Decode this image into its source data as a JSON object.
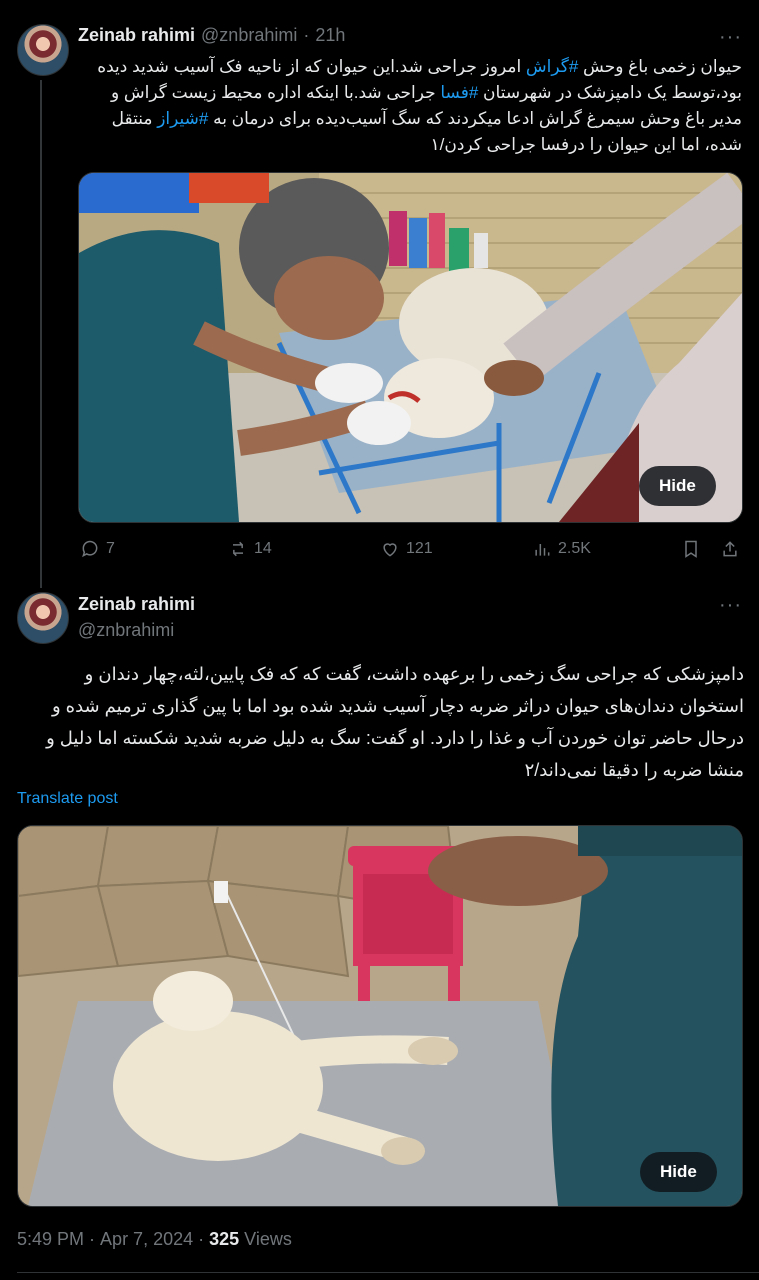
{
  "tweet1": {
    "author_name": "Zeinab rahimi",
    "handle": "@znbrahimi",
    "separator": "·",
    "time": "21h",
    "more": "···",
    "text_parts": [
      {
        "t": "حیوان زخمی باغ وحش ",
        "tag": false
      },
      {
        "t": "#گراش",
        "tag": true
      },
      {
        "t": " امروز جراحی شد.این حیوان که از ناحیه فک آسیب شدید دیده بود،توسط یک دامپزشک در شهرستان ",
        "tag": false
      },
      {
        "t": "#فسا",
        "tag": true
      },
      {
        "t": " جراحی شد.با اینکه اداره محیط زیست گراش و مدیر باغ وحش سیمرغ گراش ادعا میکردند که سگ آسیب‌دیده برای درمان به ",
        "tag": false
      },
      {
        "t": "#شیراز",
        "tag": true
      },
      {
        "t": " منتقل شده، اما این حیوان را درفسا جراحی کردن/۱",
        "tag": false
      }
    ],
    "hide_label": "Hide",
    "actions": {
      "replies": "7",
      "reposts": "14",
      "likes": "121",
      "views": "2.5K"
    }
  },
  "tweet2": {
    "author_name": "Zeinab rahimi",
    "handle": "@znbrahimi",
    "more": "···",
    "text": "دامپزشکی که جراحی سگ زخمی را برعهده داشت، گفت که که فک پایین،لثه،چهار دندان و استخوان دندان‌های حیوان دراثر ضربه دچار آسیب شدید شده بود اما با پین گذاری ترمیم شده و درحال حاضر توان خوردن آب و غذا را دارد. او گفت: سگ به دلیل ضربه شدید شکسته اما دلیل و منشا ضربه را دقیقا نمی‌داند/۲",
    "translate": "Translate post",
    "hide_label": "Hide",
    "time": "5:49 PM",
    "date_sep": "·",
    "date": "Apr 7, 2024",
    "views_sep": "·",
    "views_count": "325",
    "views_label": "Views"
  }
}
